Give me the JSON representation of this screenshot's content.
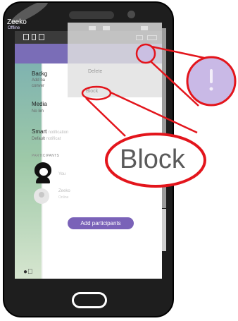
{
  "contact": {
    "name": "Zeeko",
    "status": "Offline"
  },
  "rows": {
    "background_title": "Backg",
    "background_sub1": "Add ba",
    "background_sub2": "conver",
    "media_title": "Media",
    "media_sub": "No lim",
    "smart_title": "Smart",
    "smart_faded": "notification",
    "smart_sub": "Default",
    "smart_sub_faded": "notificat",
    "participants_label": "PARTICIPANTS"
  },
  "menu": {
    "item1": "Delete",
    "item2": "Block"
  },
  "participants": [
    {
      "name": "You"
    },
    {
      "name": "Zeeko",
      "status": "Online"
    }
  ],
  "add_participants_label": "Add participants",
  "zoom_callout_label": "Block",
  "colors": {
    "header": "#7a6db7",
    "button": "#7a62b8",
    "annotation": "#e3151c",
    "overflow_circle": "#c9b9e6"
  },
  "icons": [
    "more-options-icon",
    "mic-icon",
    "notification-icon",
    "wifi-icon",
    "battery-icon"
  ]
}
